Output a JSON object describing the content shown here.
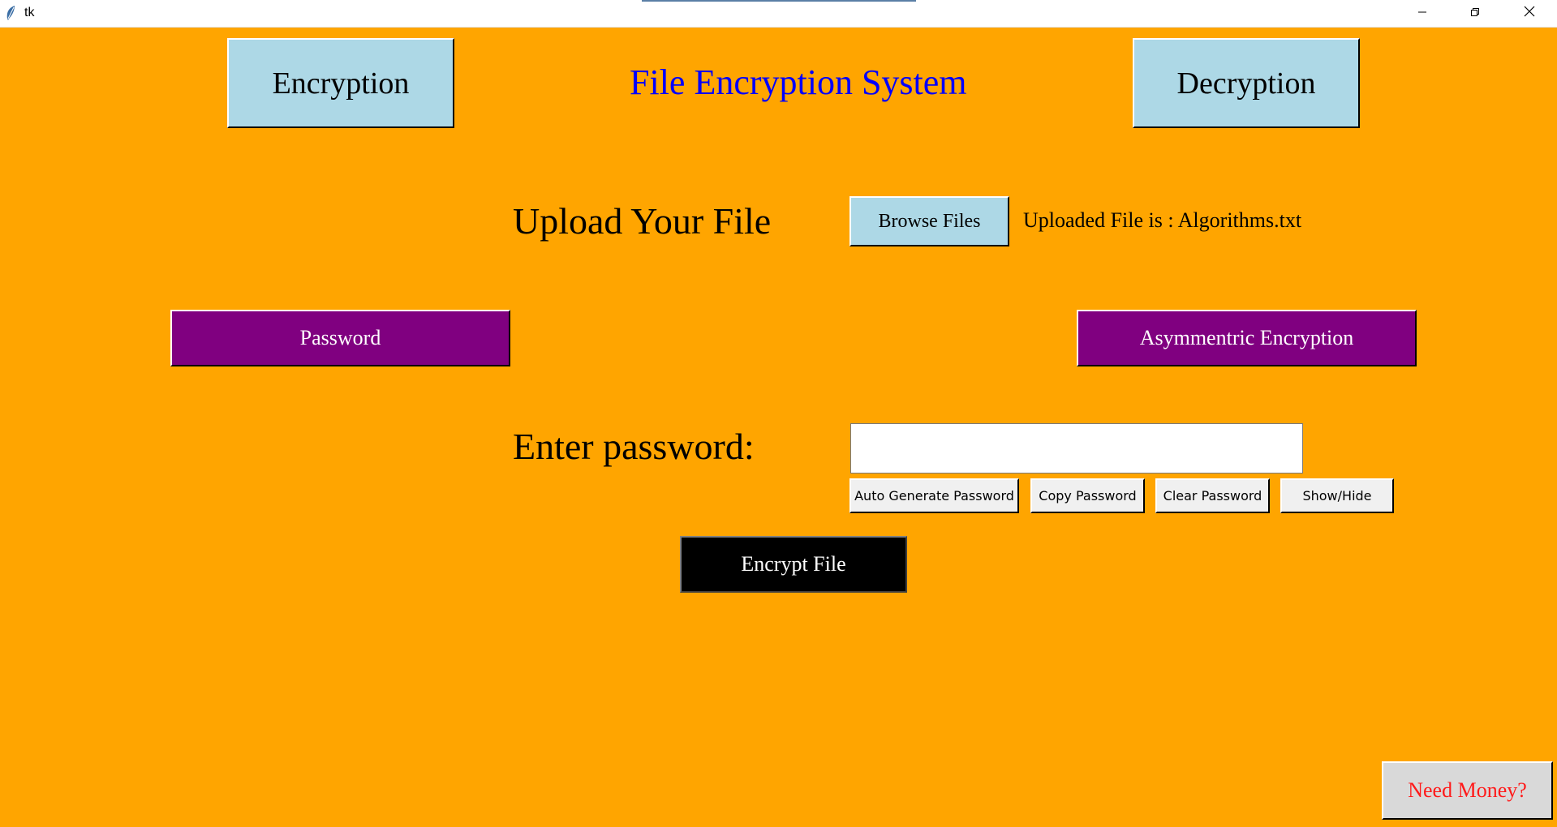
{
  "window": {
    "title": "tk"
  },
  "header": {
    "encryption_label": "Encryption",
    "app_title": "File Encryption System",
    "decryption_label": "Decryption"
  },
  "upload": {
    "heading": "Upload Your File",
    "browse_label": "Browse Files",
    "status": "Uploaded File is : Algorithms.txt"
  },
  "modes": {
    "password_label": "Password",
    "asymmetric_label": "Asymmentric Encryption"
  },
  "password_section": {
    "label": "Enter password:",
    "value": "",
    "auto_generate_label": "Auto Generate Password",
    "copy_label": "Copy Password",
    "clear_label": "Clear Password",
    "show_hide_label": "Show/Hide"
  },
  "actions": {
    "encrypt_label": "Encrypt File",
    "need_money_label": "Need Money?"
  },
  "colors": {
    "background": "#FFA500",
    "nav_button": "#ADD8E6",
    "mode_button": "#800080",
    "title_text": "#0000FF",
    "money_text": "#FF1A1A"
  },
  "icons": [
    "feather-icon",
    "minimize-icon",
    "maximize-icon",
    "close-icon"
  ]
}
